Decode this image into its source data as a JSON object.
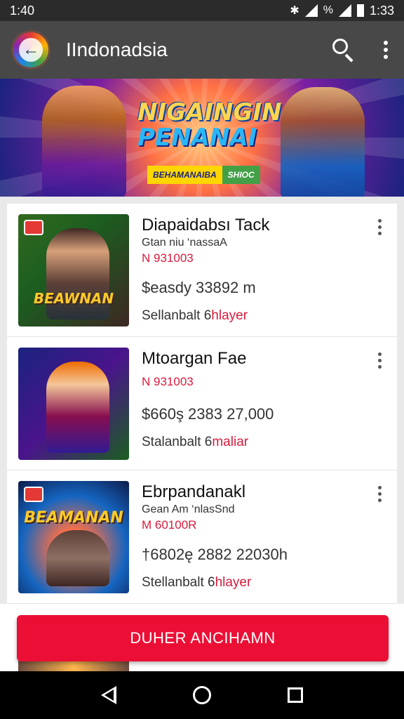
{
  "status_bar": {
    "time_left": "1:40",
    "time_right": "1:33"
  },
  "app_bar": {
    "title": "IIndonadsia",
    "back_icon": "back-arrow-icon",
    "search_icon": "search-icon",
    "menu_icon": "more-vert-icon"
  },
  "banner": {
    "title_line1": "NIGAINGIN",
    "title_line2": "PENANAI",
    "badge_left": "BEHAMANAIBA",
    "badge_right": "SHIOC"
  },
  "items": [
    {
      "title": "Diapaidabsı Tack",
      "subtitle": "Gtan niu ‘nassaA",
      "code": "N 931003",
      "price": "$easdy 33892 m",
      "seller_prefix": "Sellanbalt 6",
      "seller_highlight": "hlayer",
      "thumb_text": "BEAWNAN"
    },
    {
      "title": "Mtoargan Fae",
      "subtitle": "",
      "code": "N 931003",
      "price": "$660ş 2383 27,000",
      "seller_prefix": "Stalanbalt 6",
      "seller_highlight": "maliar",
      "thumb_text": ""
    },
    {
      "title": "Ebrpandanakl",
      "subtitle": "Gean Am ‘nlasSnd",
      "code": "M 60100R",
      "price": "†6802ę 2882 22030h",
      "seller_prefix": "Stellanbalt 6",
      "seller_highlight": "hlayer",
      "thumb_text": "BEAMANAN"
    }
  ],
  "cta": {
    "label": "DUHER ANCIHAMN"
  },
  "colors": {
    "accent": "#ec0f35",
    "app_bar": "#484848",
    "price_red": "#d81b3c"
  }
}
